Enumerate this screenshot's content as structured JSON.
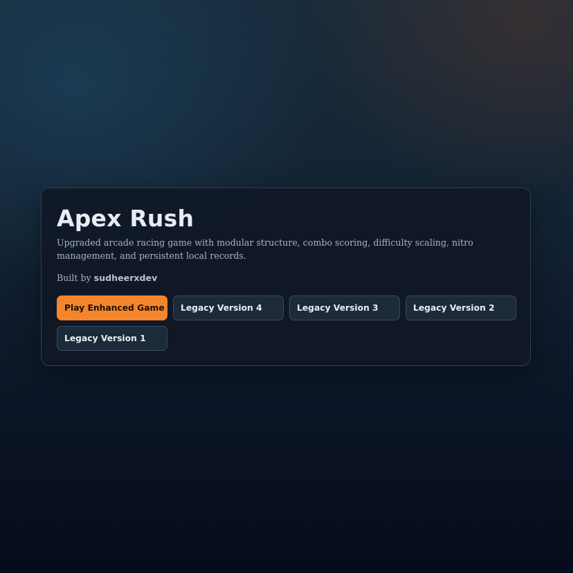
{
  "card": {
    "title": "Apex Rush",
    "description": "Upgraded arcade racing game with modular structure, combo scoring, difficulty scaling, nitro management, and persistent local records.",
    "credit_prefix": "Built by ",
    "credit_author": "sudheerxdev"
  },
  "buttons": {
    "play": "Play Enhanced Game",
    "legacy4": "Legacy Version 4",
    "legacy3": "Legacy Version 3",
    "legacy2": "Legacy Version 2",
    "legacy1": "Legacy Version 1"
  },
  "colors": {
    "accent": "#f5852b",
    "card_bg": "#101826",
    "legacy_bg": "#1c2a3a"
  }
}
